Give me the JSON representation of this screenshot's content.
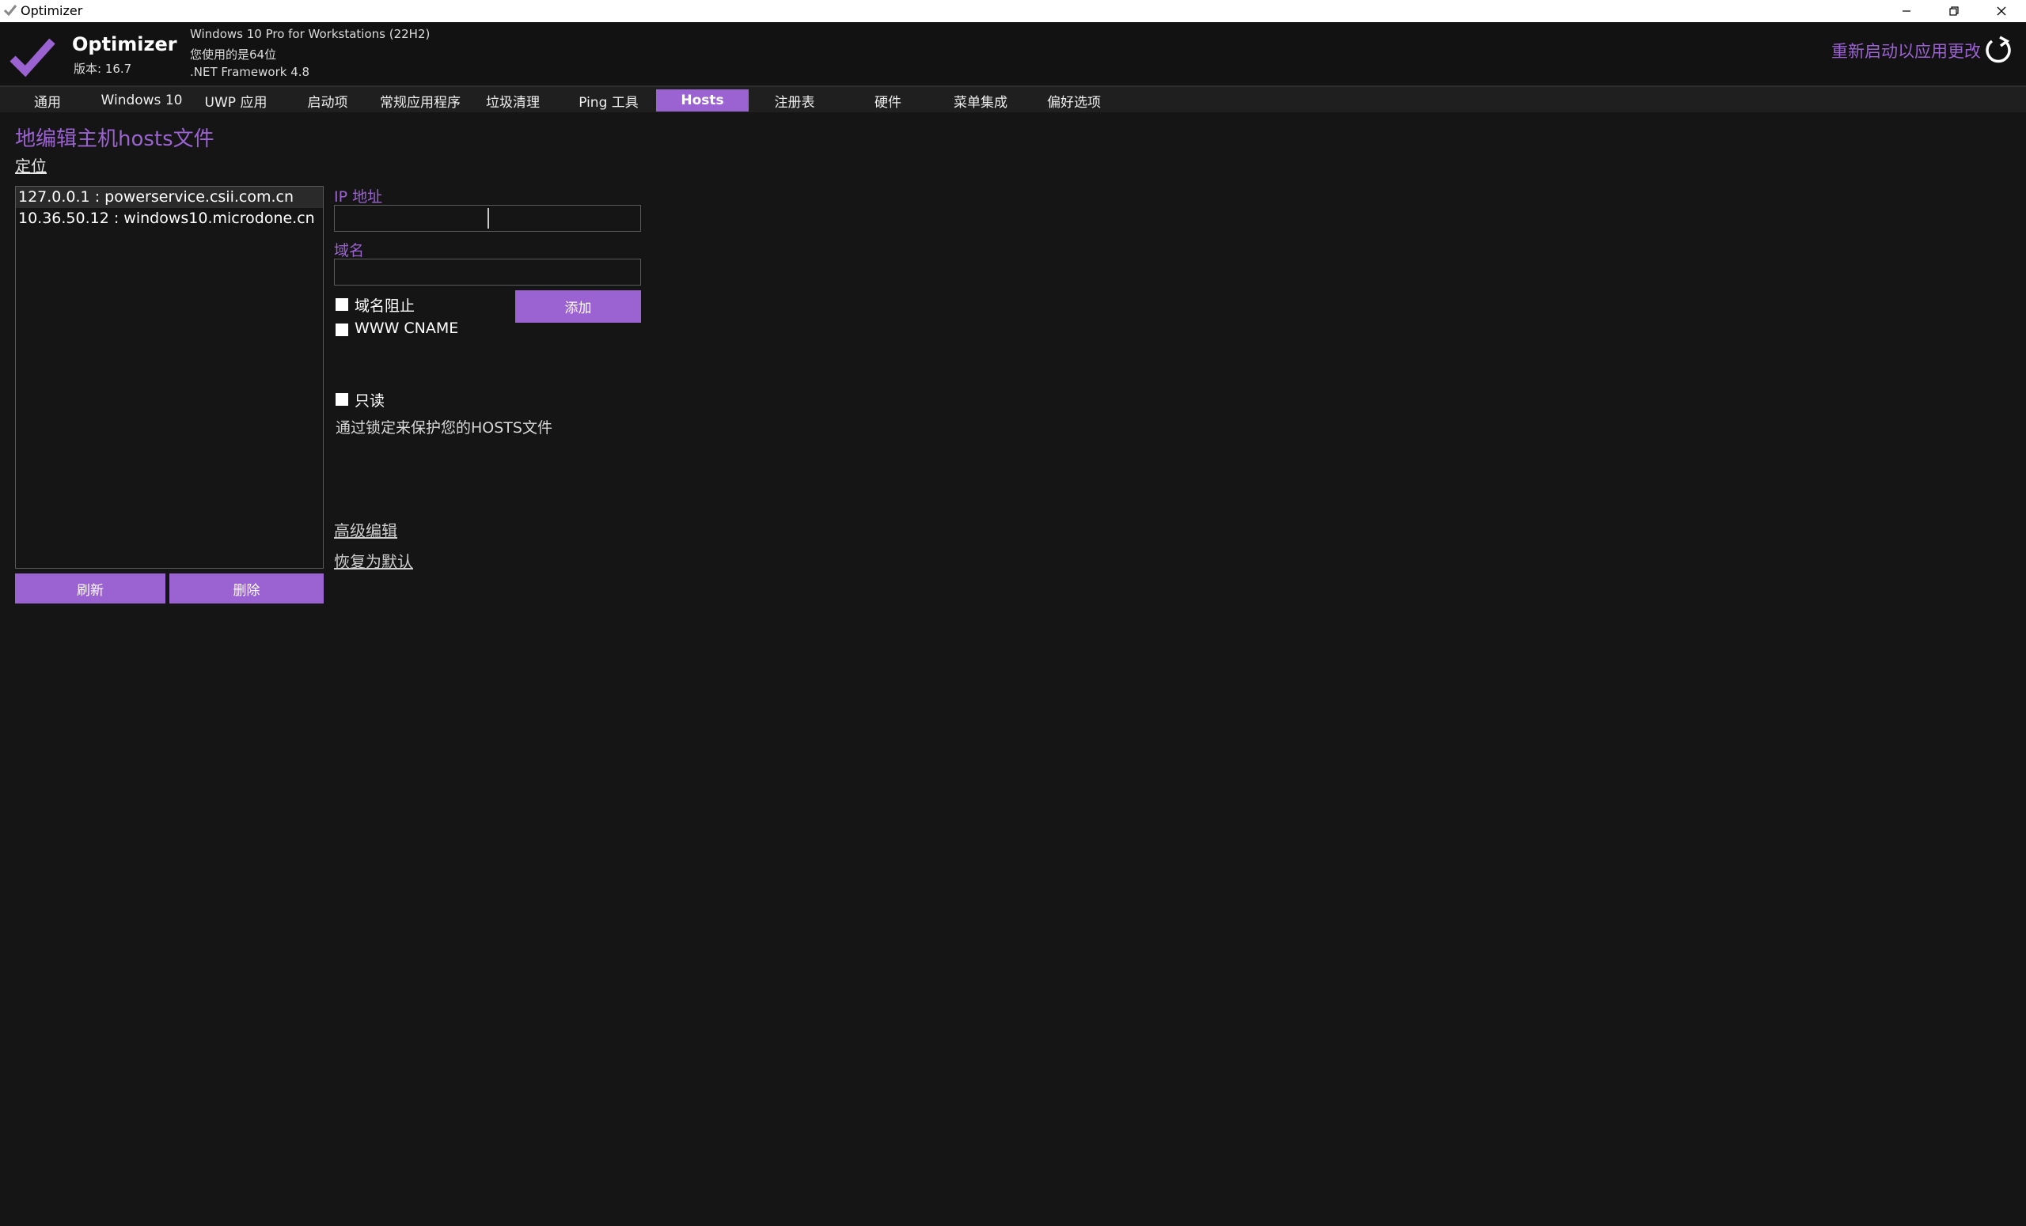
{
  "window": {
    "title": "Optimizer"
  },
  "header": {
    "app_name": "Optimizer",
    "version": "版本: 16.7",
    "os": "Windows 10 Pro for Workstations (22H2)",
    "arch": "您使用的是64位",
    "framework": ".NET Framework 4.8",
    "restart_label": "重新启动以应用更改"
  },
  "tabs": [
    {
      "label": "通用",
      "active": false
    },
    {
      "label": "Windows 10",
      "active": false
    },
    {
      "label": "UWP 应用",
      "active": false
    },
    {
      "label": "启动项",
      "active": false
    },
    {
      "label": "常规应用程序",
      "active": false
    },
    {
      "label": "垃圾清理",
      "active": false
    },
    {
      "label": "Ping 工具",
      "active": false
    },
    {
      "label": "Hosts",
      "active": true
    },
    {
      "label": "注册表",
      "active": false
    },
    {
      "label": "硬件",
      "active": false
    },
    {
      "label": "菜单集成",
      "active": false
    },
    {
      "label": "偏好选项",
      "active": false
    }
  ],
  "hosts": {
    "title": "地编辑主机hosts文件",
    "locate_link": "定位",
    "entries": [
      "127.0.0.1 : powerservice.csii.com.cn",
      "10.36.50.12 : windows10.microdone.cn"
    ],
    "selected_index": 0,
    "refresh_button": "刷新",
    "delete_button": "删除",
    "ip_label": "IP 地址",
    "ip_value": "",
    "domain_label": "域名",
    "domain_value": "",
    "block_domain_label": "域名阻止",
    "block_domain_checked": false,
    "www_cname_label": "WWW CNAME",
    "www_cname_checked": false,
    "add_button": "添加",
    "readonly_label": "只读",
    "readonly_checked": false,
    "readonly_desc": "通过锁定来保护您的HOSTS文件",
    "advanced_edit_link": "高级编辑",
    "restore_default_link": "恢复为默认"
  },
  "colors": {
    "accent": "#9b63d1",
    "background": "#151515"
  }
}
